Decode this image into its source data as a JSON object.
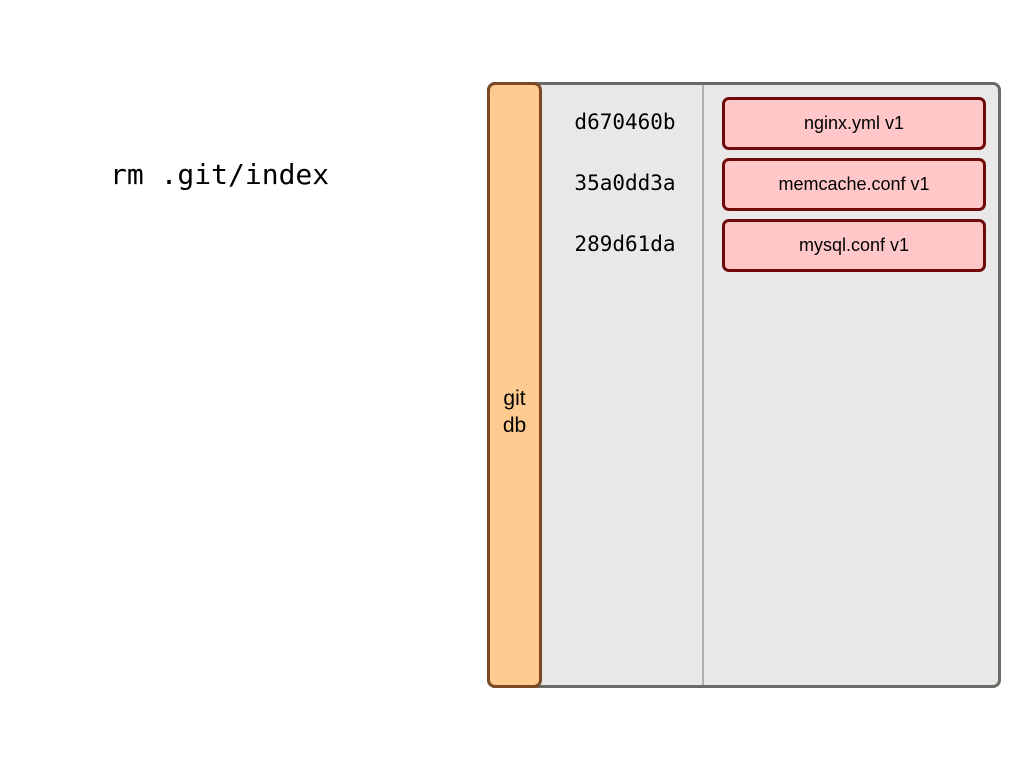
{
  "command": "rm .git/index",
  "git_db": {
    "label_line1": "git",
    "label_line2": "db"
  },
  "objects": [
    {
      "hash": "d670460b",
      "file": "nginx.yml v1"
    },
    {
      "hash": "35a0dd3a",
      "file": "memcache.conf v1"
    },
    {
      "hash": "289d61da",
      "file": "mysql.conf v1"
    }
  ],
  "colors": {
    "git_db_fill": "#fdca90",
    "git_db_border": "#7a4a25",
    "object_fill": "#ffc7c7",
    "object_border": "#700a0a",
    "container_fill": "#e8e8e8",
    "container_border": "#6d6a66"
  }
}
